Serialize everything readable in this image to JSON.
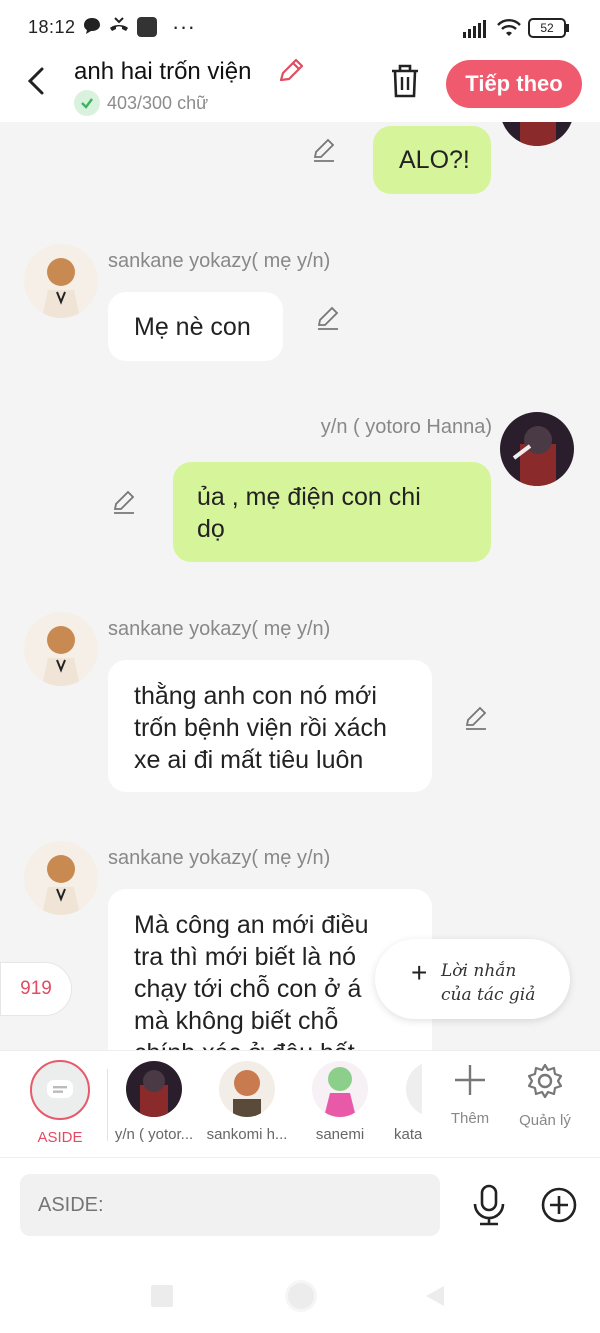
{
  "status_bar": {
    "time": "18:12",
    "more": "···",
    "battery": "52"
  },
  "header": {
    "title": "anh hai trốn viện",
    "word_count": "403/300 chữ",
    "next_label": "Tiếp theo"
  },
  "messages": [
    {
      "side": "right",
      "name": "",
      "text": "ALO?!"
    },
    {
      "side": "left",
      "name": "sankane yokazy( mẹ y/n)",
      "text": "Mẹ nè con"
    },
    {
      "side": "right",
      "name": "y/n ( yotoro Hanna)",
      "text_lines": [
        "ủa , mẹ điện con chi",
        "dọ"
      ]
    },
    {
      "side": "left",
      "name": "sankane yokazy( mẹ y/n)",
      "text_lines": [
        "thằng anh con nó mới",
        "trốn bệnh viện rồi xách",
        "xe ai đi mất tiêu luôn"
      ]
    },
    {
      "side": "left",
      "name": "sankane yokazy( mẹ y/n)",
      "text_lines": [
        "Mà công an mới điều",
        "tra thì mới biết là nó",
        "chạy tới chỗ con ở á",
        "mà không biết chỗ",
        "chính xác ở đâu hết"
      ]
    }
  ],
  "author_note": {
    "line1": "Lời nhắn",
    "line2": "của tác giả"
  },
  "side_badge": "919",
  "characters": {
    "aside_label": "ASIDE",
    "items": [
      {
        "label": "y/n ( yotor..."
      },
      {
        "label": "sankomi h..."
      },
      {
        "label": "sanemi"
      },
      {
        "label": "kata"
      }
    ],
    "add_label": "Thêm",
    "manage_label": "Quản lý"
  },
  "input": {
    "placeholder": "ASIDE:"
  },
  "colors": {
    "accent": "#f05a6e",
    "bubble_right": "#d6f59a",
    "bubble_left": "#ffffff"
  }
}
